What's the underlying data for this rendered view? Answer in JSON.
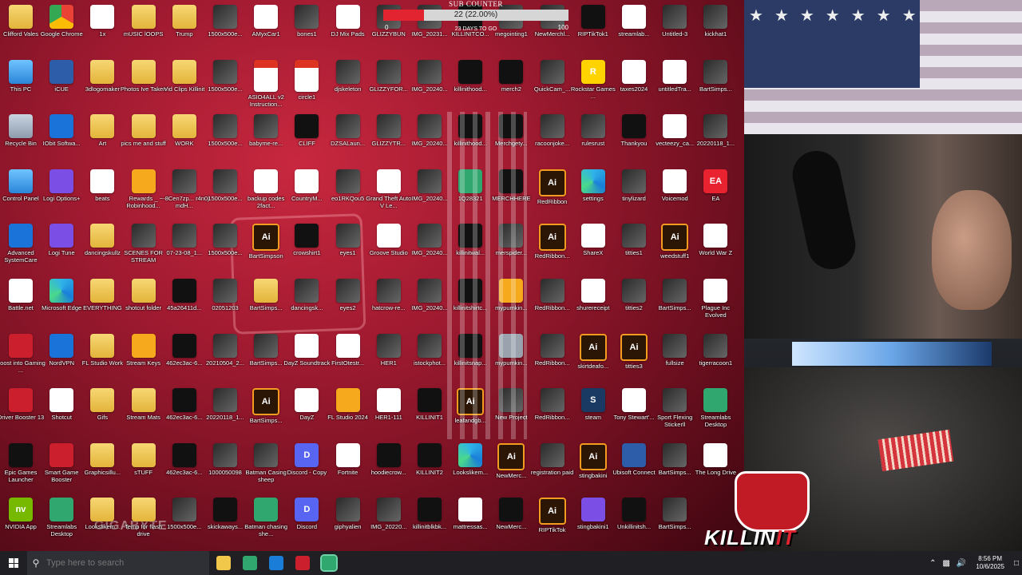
{
  "desktop": {
    "watermark": "GIGABYTE",
    "icons": [
      {
        "label": "Clifford Vales",
        "glyph": "folder",
        "icon": "folder-icon"
      },
      {
        "label": "Google Chrome",
        "glyph": "chrome",
        "icon": "chrome-icon"
      },
      {
        "label": "1x",
        "glyph": "file",
        "icon": "file-icon"
      },
      {
        "label": "mUSIC lOOPS",
        "glyph": "folder",
        "icon": "folder-icon"
      },
      {
        "label": "Trump",
        "glyph": "folder",
        "icon": "folder-icon"
      },
      {
        "label": "1500x500e...",
        "glyph": "img",
        "icon": "image-icon"
      },
      {
        "label": "AMyxCar1",
        "glyph": "file",
        "icon": "file-icon"
      },
      {
        "label": "bones1",
        "glyph": "img",
        "icon": "image-icon"
      },
      {
        "label": "DJ Mix Pads",
        "glyph": "file",
        "icon": "file-icon"
      },
      {
        "label": "GLIZZYBUN",
        "glyph": "img",
        "icon": "image-icon"
      },
      {
        "label": "IMG_20231...",
        "glyph": "img",
        "icon": "image-icon"
      },
      {
        "label": "KILLINITCO...",
        "glyph": "dark",
        "icon": "image-icon"
      },
      {
        "label": "megointing1",
        "glyph": "img",
        "icon": "image-icon"
      },
      {
        "label": "NewMerchl...",
        "glyph": "img",
        "icon": "image-icon"
      },
      {
        "label": "RIPTikTok1",
        "glyph": "dark",
        "icon": "image-icon"
      },
      {
        "label": "streamlab...",
        "glyph": "file",
        "icon": "file-icon"
      },
      {
        "label": "Untitled-3",
        "glyph": "img",
        "icon": "image-icon"
      },
      {
        "label": "kickhat1",
        "glyph": "img",
        "icon": "image-icon"
      },
      {
        "label": "This PC",
        "glyph": "pc",
        "icon": "this-pc-icon"
      },
      {
        "label": "iCUE",
        "glyph": "app",
        "icon": "icue-icon"
      },
      {
        "label": "3dlogomaker",
        "glyph": "folder",
        "icon": "folder-icon"
      },
      {
        "label": "Photos Ive Taken",
        "glyph": "folder",
        "icon": "folder-icon"
      },
      {
        "label": "Vid Clips Killinit",
        "glyph": "folder",
        "icon": "folder-icon"
      },
      {
        "label": "1500x500e...",
        "glyph": "img",
        "icon": "image-icon"
      },
      {
        "label": "ASIO4ALL v2 Instruction...",
        "glyph": "pdf",
        "icon": "pdf-icon"
      },
      {
        "label": "circle1",
        "glyph": "pdf",
        "icon": "pdf-icon"
      },
      {
        "label": "djskeleton",
        "glyph": "img",
        "icon": "image-icon"
      },
      {
        "label": "GLIZZYFOR...",
        "glyph": "img",
        "icon": "image-icon"
      },
      {
        "label": "IMG_20240...",
        "glyph": "img",
        "icon": "image-icon"
      },
      {
        "label": "killinithood...",
        "glyph": "dark",
        "icon": "image-icon"
      },
      {
        "label": "merch2",
        "glyph": "dark",
        "icon": "image-icon"
      },
      {
        "label": "QuickCam_...",
        "glyph": "img",
        "icon": "image-icon"
      },
      {
        "label": "Rockstar Games ...",
        "glyph": "yellow",
        "icon": "rockstar-icon"
      },
      {
        "label": "taxes2024",
        "glyph": "file",
        "icon": "file-icon"
      },
      {
        "label": "untitledTra...",
        "glyph": "file",
        "icon": "file-icon"
      },
      {
        "label": "BartSimps...",
        "glyph": "img",
        "icon": "image-icon"
      },
      {
        "label": "Recycle Bin",
        "glyph": "bin",
        "icon": "recycle-bin-icon"
      },
      {
        "label": "IObit Softwa...",
        "glyph": "blue",
        "icon": "iobit-icon"
      },
      {
        "label": "Art",
        "glyph": "folder",
        "icon": "folder-icon"
      },
      {
        "label": "pics me and stuff",
        "glyph": "folder",
        "icon": "folder-icon"
      },
      {
        "label": "WORK",
        "glyph": "folder",
        "icon": "folder-icon"
      },
      {
        "label": "1500x500e...",
        "glyph": "img",
        "icon": "image-icon"
      },
      {
        "label": "babyme-re...",
        "glyph": "img",
        "icon": "image-icon"
      },
      {
        "label": "CLIFF",
        "glyph": "dark",
        "icon": "image-icon"
      },
      {
        "label": "DZSALaun...",
        "glyph": "img",
        "icon": "image-icon"
      },
      {
        "label": "GLIZZYTR...",
        "glyph": "img",
        "icon": "image-icon"
      },
      {
        "label": "IMG_20240...",
        "glyph": "img",
        "icon": "image-icon"
      },
      {
        "label": "killinithood...",
        "glyph": "dark",
        "icon": "image-icon"
      },
      {
        "label": "Merchgety...",
        "glyph": "dark",
        "icon": "image-icon"
      },
      {
        "label": "racoonjoke...",
        "glyph": "img",
        "icon": "image-icon"
      },
      {
        "label": "rulesrust",
        "glyph": "img",
        "icon": "image-icon"
      },
      {
        "label": "Thankyou",
        "glyph": "dark",
        "icon": "image-icon"
      },
      {
        "label": "vecteezy_ca...",
        "glyph": "file",
        "icon": "file-icon"
      },
      {
        "label": "20220118_1...",
        "glyph": "img",
        "icon": "image-icon"
      },
      {
        "label": "Control Panel",
        "glyph": "pc",
        "icon": "control-panel-icon"
      },
      {
        "label": "Logi Options+",
        "glyph": "purple",
        "icon": "logi-options-icon"
      },
      {
        "label": "beats",
        "glyph": "file",
        "icon": "file-icon"
      },
      {
        "label": "Rewards _ Robinhood...",
        "glyph": "orange",
        "icon": "star-icon"
      },
      {
        "label": "~-8Cen7zp... r4n0j mdH...",
        "glyph": "img",
        "icon": "image-icon"
      },
      {
        "label": "1500x500e...",
        "glyph": "img",
        "icon": "image-icon"
      },
      {
        "label": "backup codes 2fact...",
        "glyph": "file",
        "icon": "file-icon"
      },
      {
        "label": "CountryM...",
        "glyph": "file",
        "icon": "file-icon"
      },
      {
        "label": "eo1RKQou5",
        "glyph": "img",
        "icon": "image-icon"
      },
      {
        "label": "Grand Theft Auto V Le...",
        "glyph": "file",
        "icon": "file-icon"
      },
      {
        "label": "IMG_20240...",
        "glyph": "img",
        "icon": "image-icon"
      },
      {
        "label": "1Q28321",
        "glyph": "green",
        "icon": "image-icon"
      },
      {
        "label": "MERCHHERE",
        "glyph": "dark",
        "icon": "image-icon"
      },
      {
        "label": "RedRibbon",
        "glyph": "ai",
        "icon": "illustrator-icon"
      },
      {
        "label": "settings",
        "glyph": "edge",
        "icon": "edge-icon"
      },
      {
        "label": "tinylizard",
        "glyph": "img",
        "icon": "image-icon"
      },
      {
        "label": "Voicemod",
        "glyph": "file",
        "icon": "file-icon"
      },
      {
        "label": "EA",
        "glyph": "ea",
        "icon": "ea-icon"
      },
      {
        "label": "Advanced SystemCare",
        "glyph": "blue",
        "icon": "advanced-systemcare-icon"
      },
      {
        "label": "Logi Tune",
        "glyph": "purple",
        "icon": "logi-tune-icon"
      },
      {
        "label": "dancingskullz",
        "glyph": "folder",
        "icon": "folder-icon"
      },
      {
        "label": "SCENES FOR STREAM",
        "glyph": "img",
        "icon": "image-icon"
      },
      {
        "label": "07-23-08_1...",
        "glyph": "img",
        "icon": "image-icon"
      },
      {
        "label": "1500x500e...",
        "glyph": "img",
        "icon": "image-icon"
      },
      {
        "label": "BartSimpson",
        "glyph": "ai",
        "icon": "illustrator-icon"
      },
      {
        "label": "crowshirt1",
        "glyph": "dark",
        "icon": "image-icon"
      },
      {
        "label": "eyes1",
        "glyph": "img",
        "icon": "image-icon"
      },
      {
        "label": "Groove Studio",
        "glyph": "file",
        "icon": "file-icon"
      },
      {
        "label": "IMG_20240...",
        "glyph": "img",
        "icon": "image-icon"
      },
      {
        "label": "killinitwal...",
        "glyph": "dark",
        "icon": "image-icon"
      },
      {
        "label": "merspider...",
        "glyph": "img",
        "icon": "image-icon"
      },
      {
        "label": "RedRibbon...",
        "glyph": "ai",
        "icon": "illustrator-icon"
      },
      {
        "label": "ShareX",
        "glyph": "file",
        "icon": "file-icon"
      },
      {
        "label": "titties1",
        "glyph": "img",
        "icon": "image-icon"
      },
      {
        "label": "weedstuff1",
        "glyph": "ai",
        "icon": "illustrator-icon"
      },
      {
        "label": "World War Z",
        "glyph": "file",
        "icon": "file-icon"
      },
      {
        "label": "Battle.net",
        "glyph": "file",
        "icon": "file-icon"
      },
      {
        "label": "Microsoft Edge",
        "glyph": "edge",
        "icon": "edge-icon"
      },
      {
        "label": "EVERYTHING",
        "glyph": "folder",
        "icon": "folder-icon"
      },
      {
        "label": "shotcut folder",
        "glyph": "folder",
        "icon": "folder-icon"
      },
      {
        "label": "45a26411d...",
        "glyph": "dark",
        "icon": "image-icon"
      },
      {
        "label": "02051203",
        "glyph": "img",
        "icon": "image-icon"
      },
      {
        "label": "BartSimps...",
        "glyph": "folder",
        "icon": "folder-icon"
      },
      {
        "label": "dancingsk...",
        "glyph": "img",
        "icon": "image-icon"
      },
      {
        "label": "eyes2",
        "glyph": "img",
        "icon": "image-icon"
      },
      {
        "label": "hatcrow-re...",
        "glyph": "img",
        "icon": "image-icon"
      },
      {
        "label": "IMG_20240...",
        "glyph": "img",
        "icon": "image-icon"
      },
      {
        "label": "killinitshirtc...",
        "glyph": "dark",
        "icon": "image-icon"
      },
      {
        "label": "mypumkin...",
        "glyph": "orange",
        "icon": "image-icon"
      },
      {
        "label": "RedRibbon...",
        "glyph": "img",
        "icon": "image-icon"
      },
      {
        "label": "shurereceipt",
        "glyph": "file",
        "icon": "file-icon"
      },
      {
        "label": "titties2",
        "glyph": "img",
        "icon": "image-icon"
      },
      {
        "label": "BartSimps...",
        "glyph": "img",
        "icon": "image-icon"
      },
      {
        "label": "Plague Inc Evolved",
        "glyph": "file",
        "icon": "file-icon"
      },
      {
        "label": "Boost into Gaming ...",
        "glyph": "red",
        "icon": "boost-gaming-icon"
      },
      {
        "label": "NordVPN",
        "glyph": "blue",
        "icon": "nordvpn-icon"
      },
      {
        "label": "FL Studio Work",
        "glyph": "folder",
        "icon": "folder-icon"
      },
      {
        "label": "Stream Keys",
        "glyph": "orange",
        "icon": "key-icon"
      },
      {
        "label": "462ec3ac-6...",
        "glyph": "dark",
        "icon": "image-icon"
      },
      {
        "label": "20210504_2...",
        "glyph": "img",
        "icon": "image-icon"
      },
      {
        "label": "BartSimps...",
        "glyph": "img",
        "icon": "image-icon"
      },
      {
        "label": "DayZ Soundtrack",
        "glyph": "file",
        "icon": "file-icon"
      },
      {
        "label": "FirstOtestr...",
        "glyph": "file",
        "icon": "file-icon"
      },
      {
        "label": "HER1",
        "glyph": "img",
        "icon": "image-icon"
      },
      {
        "label": "istockphot...",
        "glyph": "img",
        "icon": "image-icon"
      },
      {
        "label": "killinitsnap...",
        "glyph": "dark",
        "icon": "image-icon"
      },
      {
        "label": "mypumkin...",
        "glyph": "gray",
        "icon": "image-icon"
      },
      {
        "label": "RedRibbon...",
        "glyph": "img",
        "icon": "image-icon"
      },
      {
        "label": "skirtdeafo...",
        "glyph": "ai",
        "icon": "illustrator-icon"
      },
      {
        "label": "titties3",
        "glyph": "ai",
        "icon": "illustrator-icon"
      },
      {
        "label": "fullsize",
        "glyph": "img",
        "icon": "image-icon"
      },
      {
        "label": "tigerracoon1",
        "glyph": "img",
        "icon": "image-icon"
      },
      {
        "label": "Driver Booster 13",
        "glyph": "red",
        "icon": "driver-booster-icon"
      },
      {
        "label": "Shotcut",
        "glyph": "file",
        "icon": "file-icon"
      },
      {
        "label": "Gifs",
        "glyph": "folder",
        "icon": "folder-icon"
      },
      {
        "label": "Stream Mats",
        "glyph": "folder",
        "icon": "folder-icon"
      },
      {
        "label": "462ec3ac-6...",
        "glyph": "dark",
        "icon": "image-icon"
      },
      {
        "label": "20220118_1...",
        "glyph": "img",
        "icon": "image-icon"
      },
      {
        "label": "BartSimps...",
        "glyph": "ai",
        "icon": "illustrator-icon"
      },
      {
        "label": "DayZ",
        "glyph": "file",
        "icon": "file-icon"
      },
      {
        "label": "FL Studio 2024",
        "glyph": "orange",
        "icon": "fl-studio-icon"
      },
      {
        "label": "HER1-111",
        "glyph": "file",
        "icon": "file-icon"
      },
      {
        "label": "KILLINIT1",
        "glyph": "dark",
        "icon": "image-icon"
      },
      {
        "label": "leafandgb...",
        "glyph": "ai",
        "icon": "illustrator-icon"
      },
      {
        "label": "New Project",
        "glyph": "img",
        "icon": "image-icon"
      },
      {
        "label": "RedRibbon...",
        "glyph": "img",
        "icon": "image-icon"
      },
      {
        "label": "steam",
        "glyph": "steam",
        "icon": "steam-icon"
      },
      {
        "label": "Tony Stewart'...",
        "glyph": "file",
        "icon": "file-icon"
      },
      {
        "label": "Sport Flexing Stickerll",
        "glyph": "img",
        "icon": "image-icon"
      },
      {
        "label": "Streamlabs Desktop",
        "glyph": "green",
        "icon": "streamlabs-icon"
      },
      {
        "label": "Epic Games Launcher",
        "glyph": "dark",
        "icon": "epic-games-icon"
      },
      {
        "label": "Smart Game Booster",
        "glyph": "red",
        "icon": "game-booster-icon"
      },
      {
        "label": "Graphicsillu...",
        "glyph": "folder",
        "icon": "folder-icon"
      },
      {
        "label": "sTUFF",
        "glyph": "folder",
        "icon": "folder-icon"
      },
      {
        "label": "462ec3ac-6...",
        "glyph": "dark",
        "icon": "image-icon"
      },
      {
        "label": "1000050098",
        "glyph": "img",
        "icon": "image-icon"
      },
      {
        "label": "Batman Casing sheep",
        "glyph": "img",
        "icon": "image-icon"
      },
      {
        "label": "Discord - Copy",
        "glyph": "discord",
        "icon": "discord-icon"
      },
      {
        "label": "Fortnite",
        "glyph": "file",
        "icon": "file-icon"
      },
      {
        "label": "hoodiecrow...",
        "glyph": "dark",
        "icon": "image-icon"
      },
      {
        "label": "KILLINIT2",
        "glyph": "dark",
        "icon": "image-icon"
      },
      {
        "label": "Lookslikem...",
        "glyph": "edge",
        "icon": "edge-icon"
      },
      {
        "label": "NewMerc...",
        "glyph": "ai",
        "icon": "illustrator-icon"
      },
      {
        "label": "registration paid",
        "glyph": "img",
        "icon": "image-icon"
      },
      {
        "label": "stingbakini",
        "glyph": "ai",
        "icon": "illustrator-icon"
      },
      {
        "label": "Ubisoft Connect",
        "glyph": "app",
        "icon": "ubisoft-icon"
      },
      {
        "label": "BartSimps...",
        "glyph": "img",
        "icon": "image-icon"
      },
      {
        "label": "The Long Drive",
        "glyph": "file",
        "icon": "file-icon"
      },
      {
        "label": "NVIDIA App",
        "glyph": "nvidia",
        "icon": "nvidia-icon"
      },
      {
        "label": "Streamlabs Desktop",
        "glyph": "green",
        "icon": "streamlabs-icon"
      },
      {
        "label": "Lookslikem...",
        "glyph": "folder",
        "icon": "folder-icon"
      },
      {
        "label": "Temp for flash drive",
        "glyph": "folder",
        "icon": "folder-icon"
      },
      {
        "label": "1500x500e...",
        "glyph": "img",
        "icon": "image-icon"
      },
      {
        "label": "skickaways...",
        "glyph": "dark",
        "icon": "image-icon"
      },
      {
        "label": "Batman chasing she...",
        "glyph": "green",
        "icon": "image-icon"
      },
      {
        "label": "Discord",
        "glyph": "discord",
        "icon": "discord-icon"
      },
      {
        "label": "giphyalien",
        "glyph": "img",
        "icon": "image-icon"
      },
      {
        "label": "IMG_20220...",
        "glyph": "img",
        "icon": "image-icon"
      },
      {
        "label": "killinitblkbk...",
        "glyph": "dark",
        "icon": "image-icon"
      },
      {
        "label": "mattressas...",
        "glyph": "file",
        "icon": "file-icon"
      },
      {
        "label": "NewMerc...",
        "glyph": "dark",
        "icon": "image-icon"
      },
      {
        "label": "RIPTikTok",
        "glyph": "ai",
        "icon": "illustrator-icon"
      },
      {
        "label": "stingbakini1",
        "glyph": "purple",
        "icon": "image-icon"
      },
      {
        "label": "Unkillinitsh...",
        "glyph": "dark",
        "icon": "image-icon"
      },
      {
        "label": "BartSimps...",
        "glyph": "img",
        "icon": "image-icon"
      },
      {
        "label": "",
        "glyph": "none",
        "icon": ""
      }
    ]
  },
  "sub_counter": {
    "title": "SUB COUNTER",
    "value_text": "22 (22.00%)",
    "progress": 0.22,
    "min": "0",
    "max": "100",
    "days_text": "23 DAYS TO GO"
  },
  "overlay": {
    "logo_word_a": "KILLIN",
    "logo_word_b": "IT"
  },
  "taskbar": {
    "search_placeholder": "Type here to search",
    "time": "8:56 PM",
    "date": "10/6/2025",
    "pinned": [
      {
        "name": "file-explorer-icon",
        "color": "#f2c84b"
      },
      {
        "name": "xbox-icon",
        "color": "#2fa76f"
      },
      {
        "name": "edge-icon",
        "color": "#1a7ed9"
      },
      {
        "name": "app-red-icon",
        "color": "#cc1f2e"
      },
      {
        "name": "streamlabs-icon",
        "color": "#2fa76f"
      }
    ]
  },
  "colors": {
    "accent": "#e1242f",
    "taskbar": "#1f1f24"
  }
}
